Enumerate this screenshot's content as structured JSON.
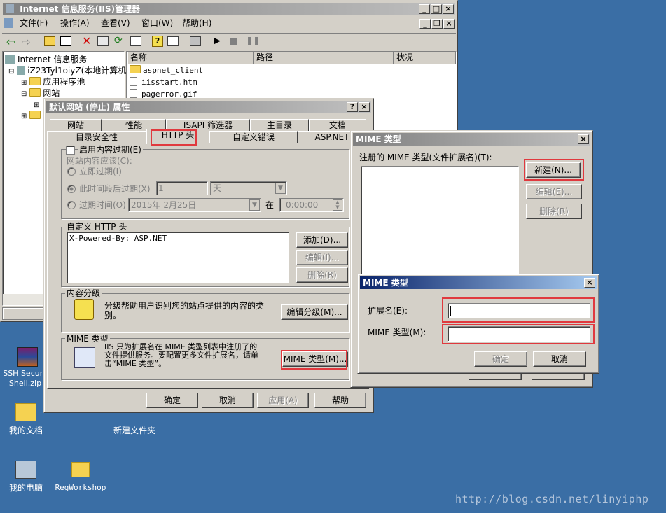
{
  "iis": {
    "title": "Internet 信息服务(IIS)管理器",
    "menu": [
      "文件(F)",
      "操作(A)",
      "查看(V)",
      "窗口(W)",
      "帮助(H)"
    ],
    "tree": {
      "root": "Internet 信息服务",
      "server": "iZ23Tyl1oiyZ(本地计算机)",
      "app_pools": "应用程序池",
      "websites": "网站"
    },
    "list_headers": [
      "名称",
      "路径",
      "状况"
    ],
    "files": [
      "aspnet_client",
      "iisstart.htm",
      "pagerror.gif"
    ]
  },
  "props": {
    "title": "默认网站 (停止) 属性",
    "tabs_row1": [
      "网站",
      "性能",
      "ISAPI 筛选器",
      "主目录",
      "文档"
    ],
    "tabs_row2": [
      "目录安全性",
      "HTTP 头",
      "自定义错误",
      "ASP.NET"
    ],
    "expire_check": "启用内容过期(E)",
    "expire_when": "网站内容应该(C):",
    "expire_now": "立即过期(I)",
    "expire_after": "此时间段后过期(X)",
    "expire_after_value": "1",
    "expire_after_unit": "天",
    "expire_on": "过期时间(O)",
    "expire_on_date": "2015年 2月25日",
    "expire_at": "在",
    "expire_on_time": "0:00:00",
    "custom_header_label": "自定义 HTTP 头",
    "custom_header_value": "X-Powered-By: ASP.NET",
    "btn_add": "添加(D)...",
    "btn_edit": "编辑(I)...",
    "btn_delete": "删除(R)",
    "rating_label": "内容分级",
    "rating_text": "分级帮助用户识别您的站点提供的内容的类别。",
    "rating_button": "编辑分级(M)...",
    "mime_label": "MIME 类型",
    "mime_text": "IIS 只为扩展名在 MIME 类型列表中注册了的文件提供服务。要配置更多文件扩展名，请单击“MIME 类型”。",
    "mime_button": "MIME 类型(M)...",
    "ok": "确定",
    "cancel": "取消",
    "apply": "应用(A)",
    "help": "帮助"
  },
  "mime_list": {
    "title": "MIME 类型",
    "registered_label": "注册的 MIME 类型(文件扩展名)(T):",
    "btn_new": "新建(N)...",
    "btn_edit": "编辑(E)...",
    "btn_delete": "删除(R)"
  },
  "mime_new": {
    "title": "MIME 类型",
    "ext_label": "扩展名(E):",
    "ext_value": "",
    "type_label": "MIME 类型(M):",
    "type_value": "",
    "ok": "确定",
    "cancel": "取消"
  },
  "desktop": {
    "icons": [
      "SSH Secure Shell.zip",
      "我的文档",
      "新建文件夹",
      "我的电脑",
      "RegWorkshop"
    ]
  },
  "watermark": "http://blog.csdn.net/linyiphp",
  "colors": {
    "desktop": "#3a6ea5",
    "active_title": "#0a246a",
    "highlight_box": "#e0393e"
  }
}
